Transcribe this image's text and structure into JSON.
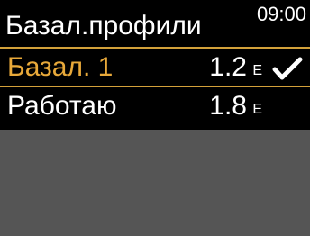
{
  "header": {
    "title": "Базал.профили",
    "time": "09:00"
  },
  "profiles": [
    {
      "name": "Базал. 1",
      "value": "1.2",
      "unit": "E",
      "active": true,
      "selected": true,
      "check_icon": "checkmark-icon"
    },
    {
      "name": "Работаю",
      "value": "1.8",
      "unit": "E",
      "active": false,
      "selected": false
    }
  ],
  "colors": {
    "background": "#000000",
    "highlight": "#e8a93a",
    "highlight_border": "#d3a13a",
    "text": "#ffffff",
    "empty_area": "#555555"
  }
}
